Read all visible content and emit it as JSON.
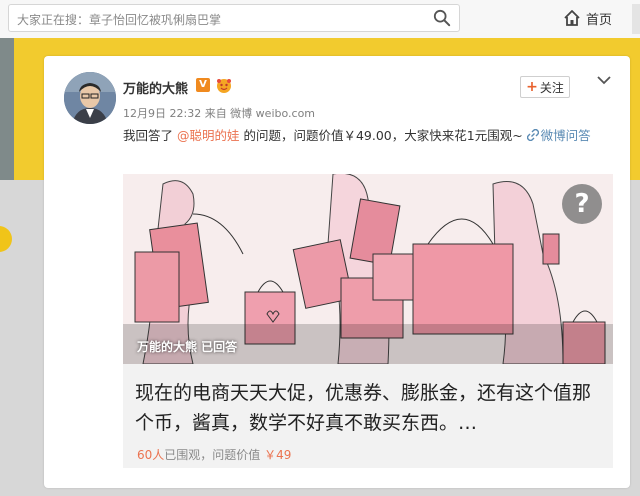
{
  "search": {
    "text": "大家正在搜：章子怡回忆被巩俐扇巴掌"
  },
  "nav": {
    "home_label": "首页"
  },
  "post": {
    "author": "万能的大熊",
    "verified_badge": "V",
    "timestamp": "12月9日 22:32 来自 微博 weibo.com",
    "follow_label": "关注",
    "text_prefix": "我回答了 ",
    "mention": "@聪明的娃",
    "text_middle": " 的问题，问题价值￥49.00，大家快来花1元围观~ ",
    "weibo_qa_link": "微博问答",
    "media_caption": "万能的大熊 已回答",
    "answer_text": "现在的电商天天大促，优惠券、膨胀金，还有这个值那个币，酱真，数学不好真不敢买东西。…",
    "watch_count": "60人",
    "watch_label": "已围观，问题价值",
    "price": "￥49"
  },
  "colors": {
    "accent_orange": "#eb7350",
    "link_blue": "#5b8bb4",
    "band_yellow": "#f2cb2e"
  }
}
